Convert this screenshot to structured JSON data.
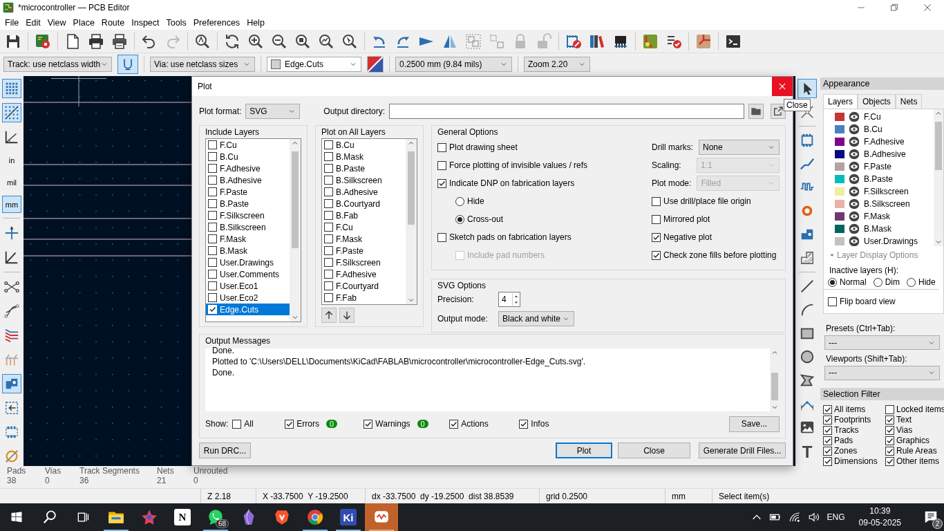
{
  "window": {
    "title": "*microcontroller — PCB Editor"
  },
  "menu": [
    "File",
    "Edit",
    "View",
    "Place",
    "Route",
    "Inspect",
    "Tools",
    "Preferences",
    "Help"
  ],
  "toolbar2": {
    "track": "Track: use netclass width",
    "track_mode_selected": true,
    "via": "Via: use netclass sizes",
    "layer": "Edge.Cuts",
    "grid": "0.2500 mm (9.84 mils)",
    "zoom": "Zoom 2.20"
  },
  "left_toolbar": [
    {
      "kind": "tool",
      "selected": true
    },
    {
      "kind": "tool",
      "selected": true
    },
    {
      "kind": "tool",
      "selected": false
    },
    {
      "kind": "unit",
      "label": "in",
      "selected": false
    },
    {
      "kind": "unit",
      "label": "mil",
      "selected": false
    },
    {
      "kind": "unit",
      "label": "mm",
      "selected": true
    },
    {
      "kind": "tool",
      "selected": false
    },
    {
      "kind": "tool",
      "selected": false
    },
    {
      "kind": "tool",
      "selected": false
    },
    {
      "kind": "tool",
      "selected": false
    },
    {
      "kind": "tool",
      "selected": false
    },
    {
      "kind": "tool",
      "selected": false
    },
    {
      "kind": "tool",
      "selected": true
    },
    {
      "kind": "tool",
      "selected": false
    },
    {
      "kind": "tool",
      "selected": false
    },
    {
      "kind": "tool",
      "selected": false
    }
  ],
  "right_toolbar": [
    {
      "kind": "tool",
      "selected": true
    },
    {
      "kind": "tool",
      "selected": false
    },
    {
      "kind": "tool",
      "selected": false
    },
    {
      "kind": "tool",
      "selected": false
    },
    {
      "kind": "tool",
      "selected": false
    },
    {
      "kind": "tool",
      "selected": false
    },
    {
      "kind": "tool",
      "selected": false
    },
    {
      "kind": "tool",
      "selected": false
    },
    {
      "kind": "tool",
      "selected": false
    },
    {
      "kind": "tool",
      "selected": false
    },
    {
      "kind": "tool",
      "selected": false
    },
    {
      "kind": "tool",
      "selected": false
    },
    {
      "kind": "tool",
      "selected": false
    },
    {
      "kind": "tool",
      "selected": false
    },
    {
      "kind": "tool",
      "selected": false
    },
    {
      "kind": "glyph",
      "label": "T",
      "selected": false
    }
  ],
  "plot_dialog": {
    "title": "Plot",
    "close_tooltip": "Close",
    "plot_format": {
      "label": "Plot format:",
      "value": "SVG"
    },
    "output_directory": {
      "label": "Output directory:"
    },
    "include_layers": {
      "title": "Include Layers",
      "items": [
        {
          "label": "F.Cu",
          "checked": false,
          "selected": false
        },
        {
          "label": "B.Cu",
          "checked": false,
          "selected": false
        },
        {
          "label": "F.Adhesive",
          "checked": false,
          "selected": false
        },
        {
          "label": "B.Adhesive",
          "checked": false,
          "selected": false
        },
        {
          "label": "F.Paste",
          "checked": false,
          "selected": false
        },
        {
          "label": "B.Paste",
          "checked": false,
          "selected": false
        },
        {
          "label": "F.Silkscreen",
          "checked": false,
          "selected": false
        },
        {
          "label": "B.Silkscreen",
          "checked": false,
          "selected": false
        },
        {
          "label": "F.Mask",
          "checked": false,
          "selected": false
        },
        {
          "label": "B.Mask",
          "checked": false,
          "selected": false
        },
        {
          "label": "User.Drawings",
          "checked": false,
          "selected": false
        },
        {
          "label": "User.Comments",
          "checked": false,
          "selected": false
        },
        {
          "label": "User.Eco1",
          "checked": false,
          "selected": false
        },
        {
          "label": "User.Eco2",
          "checked": false,
          "selected": false
        },
        {
          "label": "Edge.Cuts",
          "checked": true,
          "selected": true
        }
      ]
    },
    "plot_on_all_layers": {
      "title": "Plot on All Layers",
      "items": [
        {
          "label": "B.Cu",
          "checked": false
        },
        {
          "label": "B.Mask",
          "checked": false
        },
        {
          "label": "B.Paste",
          "checked": false
        },
        {
          "label": "B.Silkscreen",
          "checked": false
        },
        {
          "label": "B.Adhesive",
          "checked": false
        },
        {
          "label": "B.Courtyard",
          "checked": false
        },
        {
          "label": "B.Fab",
          "checked": false
        },
        {
          "label": "F.Cu",
          "checked": false
        },
        {
          "label": "F.Mask",
          "checked": false
        },
        {
          "label": "F.Paste",
          "checked": false
        },
        {
          "label": "F.Silkscreen",
          "checked": false
        },
        {
          "label": "F.Adhesive",
          "checked": false
        },
        {
          "label": "F.Courtyard",
          "checked": false
        },
        {
          "label": "F.Fab",
          "checked": false
        }
      ]
    },
    "general_options": {
      "title": "General Options",
      "left": [
        {
          "kind": "checkbox",
          "label": "Plot drawing sheet",
          "checked": false,
          "disabled": false
        },
        {
          "kind": "checkbox",
          "label": "Force plotting of invisible values / refs",
          "checked": false,
          "disabled": false
        },
        {
          "kind": "checkbox",
          "label": "Indicate DNP on fabrication layers",
          "checked": true,
          "disabled": false,
          "children": [
            {
              "kind": "radio",
              "label": "Hide",
              "selected": false,
              "disabled": false
            },
            {
              "kind": "radio",
              "label": "Cross-out",
              "selected": true,
              "disabled": false
            }
          ]
        },
        {
          "kind": "checkbox",
          "label": "Sketch pads on fabrication layers",
          "checked": false,
          "disabled": false,
          "children": [
            {
              "kind": "checkbox",
              "label": "Include pad numbers",
              "checked": false,
              "disabled": true
            }
          ]
        }
      ],
      "selects": [
        {
          "label": "Drill marks:",
          "value": "None",
          "disabled": false
        },
        {
          "label": "Scaling:",
          "value": "1:1",
          "disabled": true
        },
        {
          "label": "Plot mode:",
          "value": "Filled",
          "disabled": true
        }
      ],
      "right": [
        {
          "kind": "checkbox",
          "label": "Use drill/place file origin",
          "checked": false,
          "disabled": false
        },
        {
          "kind": "checkbox",
          "label": "Mirrored plot",
          "checked": false,
          "disabled": false
        },
        {
          "kind": "checkbox",
          "label": "Negative plot",
          "checked": true,
          "disabled": false
        },
        {
          "kind": "checkbox",
          "label": "Check zone fills before plotting",
          "checked": true,
          "disabled": false
        }
      ]
    },
    "svg_options": {
      "title": "SVG Options",
      "precision": {
        "label": "Precision:",
        "value": "4"
      },
      "output_mode": {
        "label": "Output mode:",
        "value": "Black and white"
      }
    },
    "output_messages": {
      "title": "Output Messages",
      "lines": [
        "Done.",
        "Plotted to 'C:\\Users\\DELL\\Documents\\KiCad\\FABLAB\\microcontroller\\microcontroller-Edge_Cuts.svg'.",
        "Done."
      ],
      "show_label": "Show:",
      "filters": [
        {
          "label": "All",
          "checked": false
        },
        {
          "label": "Errors",
          "checked": true,
          "count": "0"
        },
        {
          "label": "Warnings",
          "checked": true,
          "count": "0"
        },
        {
          "label": "Actions",
          "checked": true
        },
        {
          "label": "Infos",
          "checked": true
        }
      ],
      "save": "Save..."
    },
    "buttons": [
      {
        "label": "Run DRC...",
        "default": false
      },
      {
        "label": "Plot",
        "default": true
      },
      {
        "label": "Close",
        "default": false
      },
      {
        "label": "Generate Drill Files...",
        "default": false
      }
    ]
  },
  "appearance": {
    "title": "Appearance",
    "tabs": [
      {
        "label": "Layers",
        "selected": true
      },
      {
        "label": "Objects",
        "selected": false
      },
      {
        "label": "Nets",
        "selected": false
      }
    ],
    "layers": [
      {
        "name": "F.Cu",
        "color": "#c83434"
      },
      {
        "name": "B.Cu",
        "color": "#4d7fc4"
      },
      {
        "name": "F.Adhesive",
        "color": "#84008a"
      },
      {
        "name": "B.Adhesive",
        "color": "#0a0a80"
      },
      {
        "name": "F.Paste",
        "color": "#b4a49e"
      },
      {
        "name": "B.Paste",
        "color": "#00bcbc"
      },
      {
        "name": "F.Silkscreen",
        "color": "#f2eda1"
      },
      {
        "name": "B.Silkscreen",
        "color": "#e8b2a7"
      },
      {
        "name": "F.Mask",
        "color": "#6e3a6e"
      },
      {
        "name": "B.Mask",
        "color": "#02635f"
      },
      {
        "name": "User.Drawings",
        "color": "#c2c2c2"
      }
    ],
    "layer_display_options": "Layer Display Options",
    "inactive_layers": {
      "label": "Inactive layers (H):",
      "options": [
        {
          "label": "Normal",
          "selected": true
        },
        {
          "label": "Dim",
          "selected": false
        },
        {
          "label": "Hide",
          "selected": false
        }
      ]
    },
    "flip_board_view": {
      "label": "Flip board view",
      "checked": false
    },
    "presets": {
      "label": "Presets (Ctrl+Tab):",
      "value": "---"
    },
    "viewports": {
      "label": "Viewports (Shift+Tab):",
      "value": "---"
    }
  },
  "selection_filter": {
    "title": "Selection Filter",
    "items": [
      {
        "label": "All items",
        "checked": true
      },
      {
        "label": "Locked items",
        "checked": false
      },
      {
        "label": "Footprints",
        "checked": true
      },
      {
        "label": "Text",
        "checked": true
      },
      {
        "label": "Tracks",
        "checked": true
      },
      {
        "label": "Vias",
        "checked": true
      },
      {
        "label": "Pads",
        "checked": true
      },
      {
        "label": "Graphics",
        "checked": true
      },
      {
        "label": "Zones",
        "checked": true
      },
      {
        "label": "Rule Areas",
        "checked": true
      },
      {
        "label": "Dimensions",
        "checked": true
      },
      {
        "label": "Other items",
        "checked": true
      }
    ]
  },
  "board_stats": [
    {
      "label": "Pads",
      "value": "38"
    },
    {
      "label": "Vias",
      "value": "0"
    },
    {
      "label": "Track Segments",
      "value": "36"
    },
    {
      "label": "Nets",
      "value": "21"
    },
    {
      "label": "Unrouted",
      "value": "0"
    }
  ],
  "status_bar": [
    "Z 2.18",
    "X -33.7500  Y -19.2500",
    "dx -33.7500  dy -19.2500  dist 38.8539",
    "grid 0.2500",
    "mm",
    "Select item(s)"
  ],
  "taskbar": {
    "apps": [
      {
        "kind": "folder",
        "running": true,
        "active": false
      },
      {
        "kind": "app",
        "running": false,
        "active": false
      },
      {
        "kind": "letter",
        "label": "N",
        "running": false,
        "active": false
      },
      {
        "kind": "chat",
        "badge": "68",
        "running": true,
        "active": false
      },
      {
        "kind": "gem",
        "running": false,
        "active": false
      },
      {
        "kind": "shield",
        "running": false,
        "active": false
      },
      {
        "kind": "browser",
        "running": true,
        "active": false
      },
      {
        "kind": "letter",
        "label": "Ki",
        "running": true,
        "active": false
      },
      {
        "kind": "viewer",
        "running": true,
        "active": true
      }
    ],
    "language": "ENG",
    "time": "10:39",
    "date": "09-05-2025",
    "notifications": "2"
  }
}
